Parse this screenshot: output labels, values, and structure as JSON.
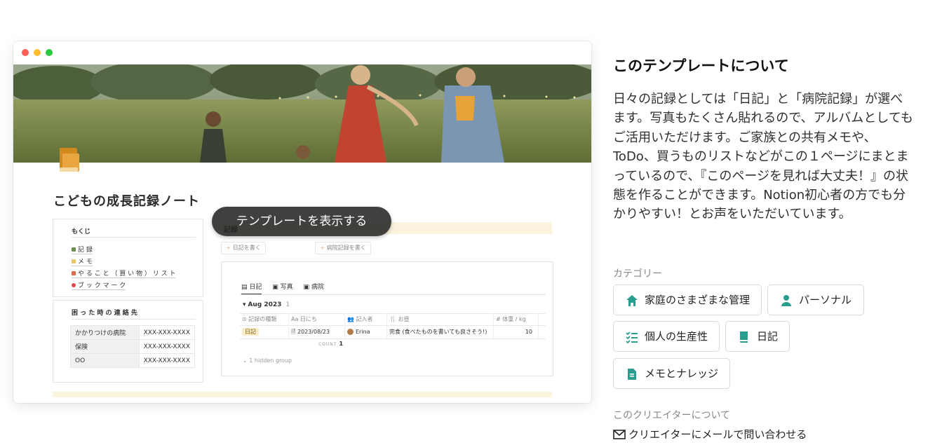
{
  "preview": {
    "page_title": "こどもの成長記録ノート",
    "overlay_button": "テンプレートを表示する",
    "toc": {
      "heading": "もくじ",
      "items": [
        {
          "label": "記 録",
          "color": "#6b8e4e"
        },
        {
          "label": "メ モ",
          "color": "#e8c66a"
        },
        {
          "label": "や る こ と （ 買 い 物 ） リ ス ト",
          "color": "#e06a4a"
        },
        {
          "label": "ブ ッ ク マ ー ク",
          "color": "#e04848"
        }
      ]
    },
    "contacts": {
      "heading": "困 っ た 時 の 連 絡 先",
      "rows": [
        {
          "key": "かかりつけの病院",
          "value": "XXX-XXX-XXXX"
        },
        {
          "key": "保険",
          "value": "XXX-XXX-XXXX"
        },
        {
          "key": "OO",
          "value": "XXX-XXX-XXXX"
        }
      ]
    },
    "record_section_label": "記録",
    "add_diary_button": "日記を書く",
    "add_hospital_button": "病院記録を書く",
    "database": {
      "tabs": [
        "日記",
        "写真",
        "病院"
      ],
      "group_title": "Aug 2023",
      "group_count": "1",
      "columns": [
        "記録の種類",
        "日にち",
        "記入者",
        "お昼",
        "# 体重 / kg"
      ],
      "row": {
        "type": "日記",
        "date": "2023/08/23",
        "author": "Erina",
        "lunch": "完食 (食べたものを書いても良さそう!)",
        "weight": "10"
      },
      "count_label": "COUNT",
      "count_value": "1",
      "hidden_group": "1 hidden group"
    }
  },
  "about": {
    "title": "このテンプレートについて",
    "description": "日々の記録としては「日記」と「病院記録」が選べます。写真もたくさん貼れるので、アルバムとしてもご活用いただけます。ご家族との共有メモや、ToDo、買うものリストなどがこの１ページにまとまっているので、『このページを見れば大丈夫！』の状態を作ることができます。Notion初心者の方でも分かりやすい！とお声をいただいています。"
  },
  "categories": {
    "label": "カテゴリー",
    "items": [
      {
        "label": "家庭のさまざまな管理",
        "icon": "home-icon"
      },
      {
        "label": "パーソナル",
        "icon": "person-icon"
      },
      {
        "label": "個人の生産性",
        "icon": "checklist-icon"
      },
      {
        "label": "日記",
        "icon": "book-icon"
      },
      {
        "label": "メモとナレッジ",
        "icon": "document-icon"
      }
    ],
    "icon_color": "#2a9d8f"
  },
  "creator": {
    "label": "このクリエイターについて",
    "contact_link": "クリエイターにメールで問い合わせる"
  }
}
